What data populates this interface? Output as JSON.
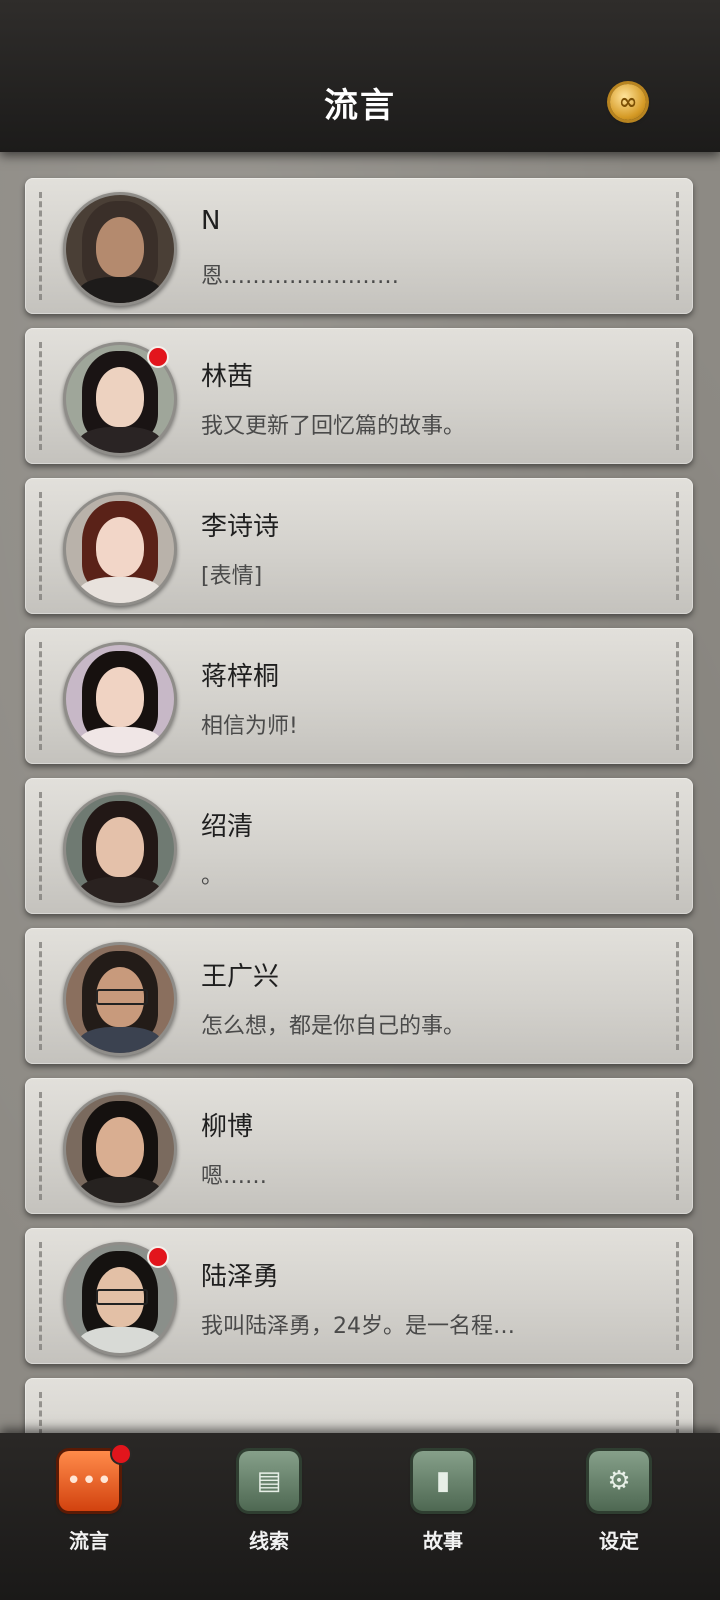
{
  "header": {
    "title": "流言",
    "coin_glyph": "∞",
    "coin_icon": "infinity-coin-icon"
  },
  "conversations": [
    {
      "name": "N",
      "message": "恩……………………",
      "unread": false,
      "avatar_skin": "#b48a6e",
      "avatar_hair": "#3a2f29",
      "avatar_bg": "#4a3f36",
      "avatar_clothes": "#1d1b1a"
    },
    {
      "name": "林茜",
      "message": "我又更新了回忆篇的故事。",
      "unread": true,
      "avatar_skin": "#edd2c0",
      "avatar_hair": "#1a1414",
      "avatar_bg": "#9fa69a",
      "avatar_clothes": "#2a2424"
    },
    {
      "name": "李诗诗",
      "message": "[表情]",
      "unread": false,
      "avatar_skin": "#f2d6c8",
      "avatar_hair": "#5a2218",
      "avatar_bg": "#b9b2aa",
      "avatar_clothes": "#e8e2dd"
    },
    {
      "name": "蒋梓桐",
      "message": "相信为师!",
      "unread": false,
      "avatar_skin": "#f0d3c3",
      "avatar_hair": "#17110f",
      "avatar_bg": "#c7b8c7",
      "avatar_clothes": "#f0e6e6"
    },
    {
      "name": "绍清",
      "message": "。",
      "unread": false,
      "avatar_skin": "#e4c1aa",
      "avatar_hair": "#221816",
      "avatar_bg": "#6f7a72",
      "avatar_clothes": "#2a2220"
    },
    {
      "name": "王广兴",
      "message": "怎么想，都是你自己的事。",
      "unread": false,
      "avatar_skin": "#c89a7c",
      "avatar_hair": "#231c18",
      "avatar_bg": "#8a6f5e",
      "avatar_clothes": "#3b4250",
      "glasses": true
    },
    {
      "name": "柳博",
      "message": "嗯……",
      "unread": false,
      "avatar_skin": "#d9ae91",
      "avatar_hair": "#15110f",
      "avatar_bg": "#7a6a5e",
      "avatar_clothes": "#262220"
    },
    {
      "name": "陆泽勇",
      "message": "我叫陆泽勇，24岁。是一名程…",
      "unread": true,
      "avatar_skin": "#e3c0a6",
      "avatar_hair": "#151210",
      "avatar_bg": "#8a8f8a",
      "avatar_clothes": "#d8dad6",
      "glasses": true
    }
  ],
  "nav": [
    {
      "label": "流言",
      "icon": "chat-bubble-icon",
      "glyph": "•••",
      "active": true,
      "badge": true
    },
    {
      "label": "线索",
      "icon": "clue-document-icon",
      "glyph": "▤",
      "active": false,
      "badge": false
    },
    {
      "label": "故事",
      "icon": "story-book-icon",
      "glyph": "▮",
      "active": false,
      "badge": false
    },
    {
      "label": "设定",
      "icon": "settings-gear-icon",
      "glyph": "⚙",
      "active": false,
      "badge": false
    }
  ]
}
